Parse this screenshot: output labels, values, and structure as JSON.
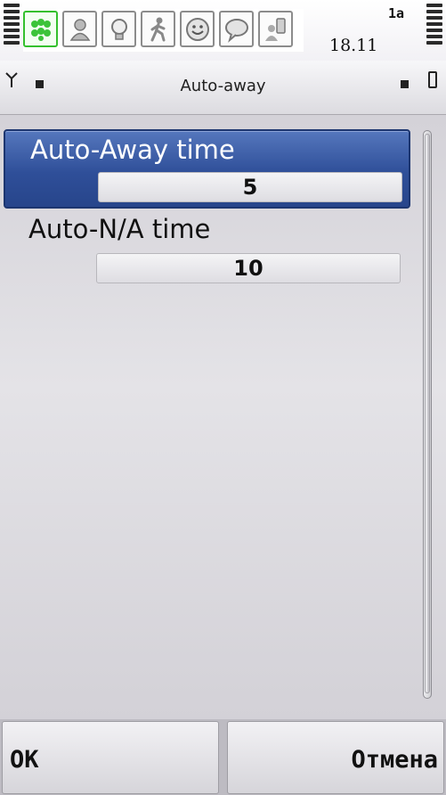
{
  "status": {
    "time": "18.11",
    "indicator": "1a",
    "tray_icons": [
      "contacts-icon",
      "person-icon",
      "lightbulb-icon",
      "walking-person-icon",
      "smiley-icon",
      "speech-bubble-icon",
      "phone-person-icon"
    ],
    "active_color": "#34c02e"
  },
  "title": "Auto-away",
  "settings": [
    {
      "label": "Auto-Away time",
      "value": "5",
      "selected": true
    },
    {
      "label": "Auto-N/A time",
      "value": "10",
      "selected": false
    }
  ],
  "softkeys": {
    "left": "OK",
    "right": "Отмена"
  },
  "colors": {
    "selection": "#2f4f99",
    "background": "#d4d2d8"
  }
}
